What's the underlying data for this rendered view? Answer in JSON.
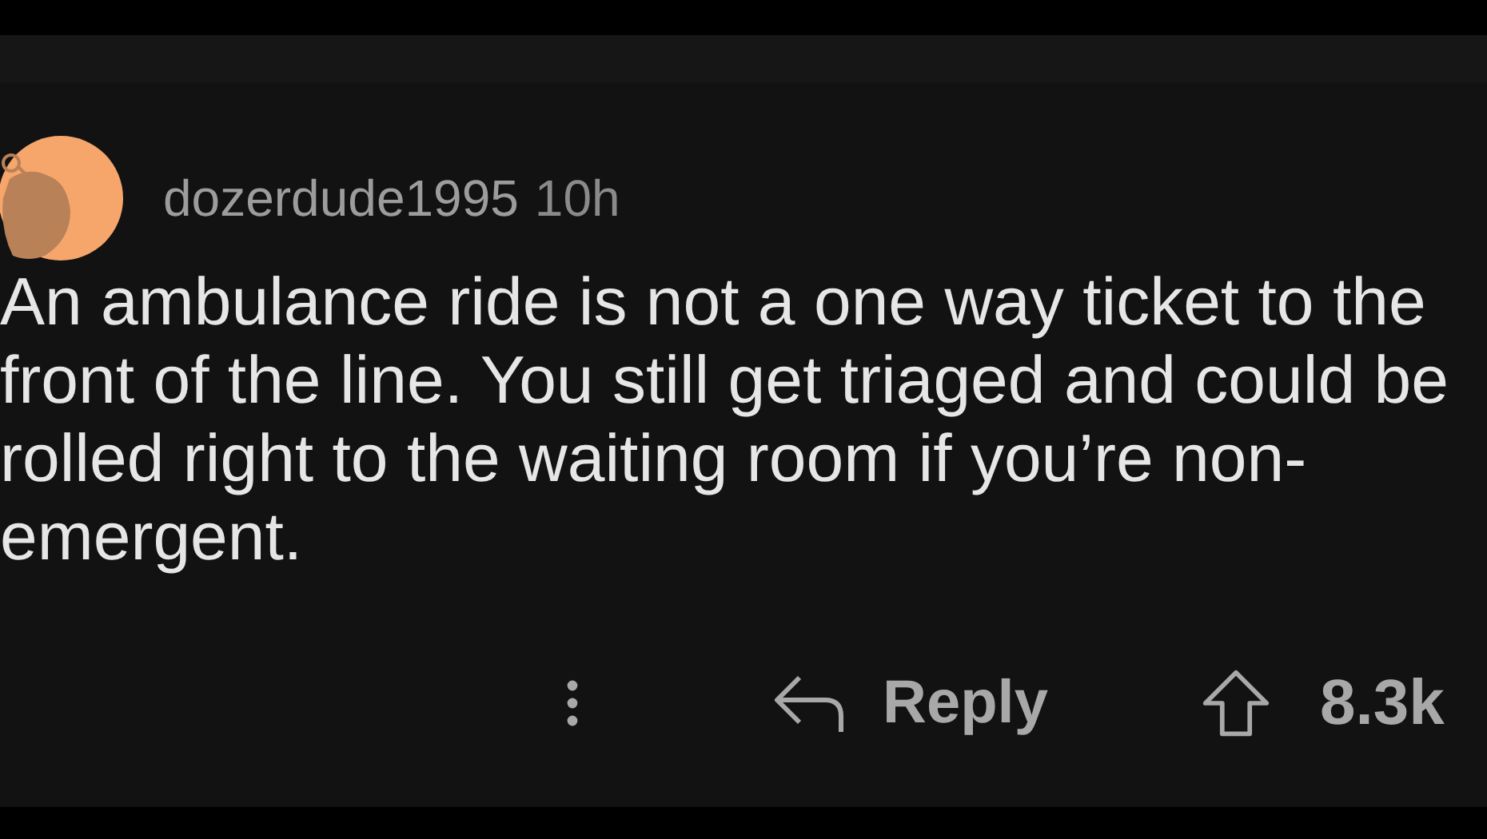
{
  "comment": {
    "author": "dozerdude1995",
    "time": "10h",
    "body": "An ambulance ride is not a one way ticket to the front of the line. You still get triaged and could be rolled right to the waiting room if you’re non-emergent.",
    "actions": {
      "reply": "Reply",
      "score": "8.3k"
    }
  }
}
